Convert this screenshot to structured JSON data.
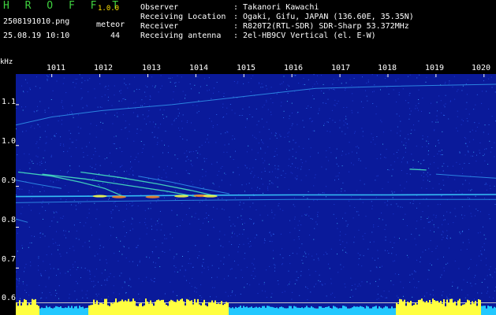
{
  "header": {
    "app_title": "H R O F F T",
    "app_version": "1.0.0",
    "file_name": "2508191010.png",
    "meteor_label": "meteor",
    "timestamp": "25.08.19 10:10",
    "meteor_count": "44",
    "info": [
      {
        "key": "Observer",
        "value": ": Takanori Kawachi"
      },
      {
        "key": "Receiving Location",
        "value": ": Ogaki, Gifu, JAPAN (136.60E, 35.35N)"
      },
      {
        "key": "Receiver",
        "value": ": R820T2(RTL-SDR) SDR-Sharp 53.372MHz"
      },
      {
        "key": "Receiving antenna",
        "value": ": 2el-HB9CV Vertical (el. E-W)"
      }
    ]
  },
  "colors": {
    "title_green": "#3fd13f",
    "version_yellow": "#ffe000",
    "background_blue": "#0a1a9a",
    "signal_cyan": "#3ad0ff",
    "signal_yellow": "#ffff40",
    "signal_orange": "#ff8a20",
    "bottom_bar": "#22c8ff"
  },
  "chart_data": {
    "type": "heatmap",
    "xlabel": "",
    "ylabel": "kHz",
    "x_tick_labels": [
      "1011",
      "1012",
      "1013",
      "1014",
      "1015",
      "1016",
      "1017",
      "1018",
      "1019",
      "1020"
    ],
    "y_tick_labels": [
      "1.1",
      "1.0",
      "0.9",
      "0.8",
      "0.7",
      "0.6"
    ],
    "x_ticks": [
      1011,
      1012,
      1013,
      1014,
      1015,
      1016,
      1017,
      1018,
      1019,
      1020
    ],
    "y_ticks": [
      1.1,
      1.0,
      0.9,
      0.8,
      0.7,
      0.6
    ],
    "xlim": [
      1010.25,
      1020.25
    ],
    "ylim": [
      0.585,
      1.175
    ],
    "traces": [
      {
        "kind": "carrier",
        "points": [
          [
            1010.25,
            0.875
          ],
          [
            1012,
            0.876
          ],
          [
            1014,
            0.878
          ],
          [
            1016,
            0.879
          ],
          [
            1018,
            0.879
          ],
          [
            1020.25,
            0.88
          ]
        ],
        "intensity": "strong"
      },
      {
        "kind": "drift",
        "points": [
          [
            1010.25,
            1.05
          ],
          [
            1011,
            1.07
          ],
          [
            1012,
            1.085
          ],
          [
            1013.5,
            1.1
          ],
          [
            1015,
            1.12
          ],
          [
            1016.5,
            1.14
          ],
          [
            1018,
            1.145
          ],
          [
            1020.25,
            1.15
          ]
        ],
        "intensity": "weak"
      },
      {
        "kind": "meteor",
        "points": [
          [
            1010.3,
            0.935
          ],
          [
            1011,
            0.925
          ],
          [
            1011.6,
            0.91
          ],
          [
            1012.1,
            0.895
          ],
          [
            1012.5,
            0.875
          ]
        ],
        "intensity": "medium"
      },
      {
        "kind": "meteor",
        "points": [
          [
            1010.8,
            0.93
          ],
          [
            1011.7,
            0.918
          ],
          [
            1012.6,
            0.902
          ],
          [
            1013.4,
            0.888
          ],
          [
            1014.0,
            0.875
          ]
        ],
        "intensity": "medium"
      },
      {
        "kind": "meteor",
        "points": [
          [
            1011.6,
            0.935
          ],
          [
            1012.4,
            0.922
          ],
          [
            1013.2,
            0.906
          ],
          [
            1013.9,
            0.89
          ],
          [
            1014.4,
            0.877
          ]
        ],
        "intensity": "medium"
      },
      {
        "kind": "meteor",
        "points": [
          [
            1012.8,
            0.925
          ],
          [
            1013.5,
            0.91
          ],
          [
            1014.1,
            0.895
          ],
          [
            1014.7,
            0.882
          ]
        ],
        "intensity": "weak"
      },
      {
        "kind": "meteor",
        "points": [
          [
            1010.25,
            0.915
          ],
          [
            1010.7,
            0.905
          ],
          [
            1011.2,
            0.895
          ]
        ],
        "intensity": "weak"
      },
      {
        "kind": "meteor",
        "points": [
          [
            1018.45,
            0.942
          ],
          [
            1018.8,
            0.94
          ]
        ],
        "intensity": "medium"
      },
      {
        "kind": "meteor",
        "points": [
          [
            1010.25,
            0.82
          ],
          [
            1010.5,
            0.812
          ]
        ],
        "intensity": "weak"
      },
      {
        "kind": "drift",
        "points": [
          [
            1019.0,
            0.93
          ],
          [
            1019.6,
            0.925
          ],
          [
            1020.25,
            0.92
          ]
        ],
        "intensity": "weak"
      },
      {
        "kind": "drift",
        "points": [
          [
            1010.25,
            0.86
          ],
          [
            1012,
            0.863
          ],
          [
            1014,
            0.866
          ],
          [
            1016,
            0.868
          ],
          [
            1018,
            0.868
          ],
          [
            1020.25,
            0.868
          ]
        ],
        "intensity": "weak"
      }
    ],
    "bright_spots": [
      [
        1012.0,
        0.876
      ],
      [
        1012.4,
        0.874
      ],
      [
        1013.7,
        0.876
      ],
      [
        1014.1,
        0.877
      ],
      [
        1014.3,
        0.876
      ],
      [
        1013.1,
        0.874
      ]
    ],
    "level_lines": [
      0.615,
      0.6
    ],
    "background_noise": "uniform"
  }
}
